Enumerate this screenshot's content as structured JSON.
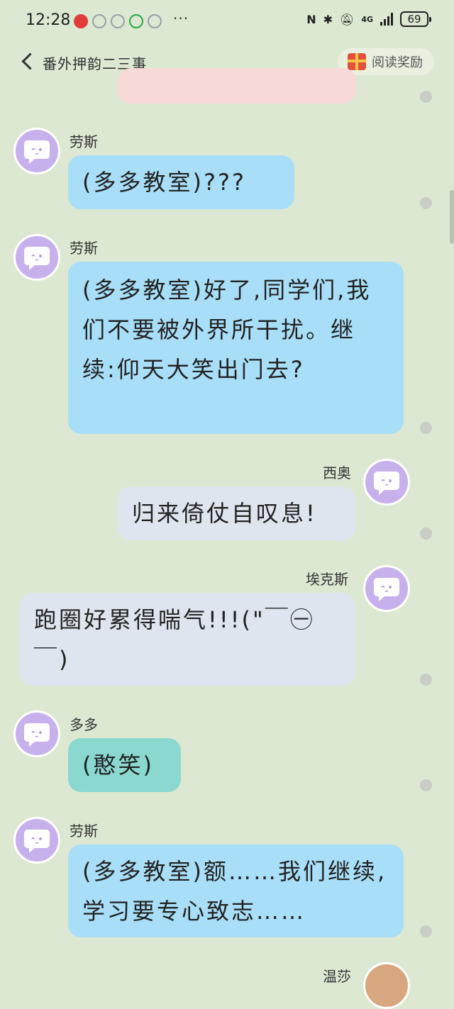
{
  "status_bar": {
    "time": "12:28",
    "more": "···",
    "network": "4G",
    "battery": "69"
  },
  "nav": {
    "title": "番外押韵二三事",
    "reward_label": "阅读奖励"
  },
  "messages": [
    {
      "sender": "劳斯",
      "text": "(多多教室)???"
    },
    {
      "sender": "劳斯",
      "text": "(多多教室)好了,同学们,我们不要被外界所干扰。继续:仰天大笑出门去?"
    },
    {
      "sender": "西奥",
      "text": "归来倚仗自叹息!"
    },
    {
      "sender": "埃克斯",
      "text": "跑圈好累得喘气!!!(\"￣㊀￣)"
    },
    {
      "sender": "多多",
      "text": "(憨笑)"
    },
    {
      "sender": "劳斯",
      "text": "(多多教室)额……我们继续,学习要专心致志……"
    },
    {
      "sender": "温莎",
      "text": ""
    }
  ],
  "colors": {
    "background": "#dce8d2",
    "bubble_blue": "#a8def7",
    "bubble_grey": "#dfe5ee",
    "bubble_teal": "#8ad8cf",
    "avatar": "#c7b1ec"
  },
  "icons": [
    "back-icon",
    "gift-icon",
    "avatar-icon",
    "bluetooth-icon",
    "mute-icon",
    "nfc-icon"
  ]
}
